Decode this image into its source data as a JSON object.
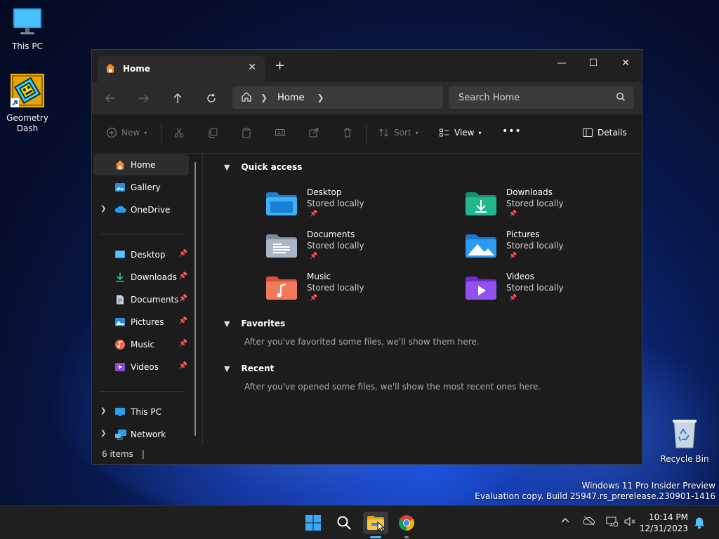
{
  "desktop": {
    "icons": [
      {
        "label": "This PC"
      },
      {
        "label": "Geometry\nDash"
      },
      {
        "label": "Recycle Bin"
      }
    ],
    "watermark_line1": "Windows 11 Pro Insider Preview",
    "watermark_line2": "Evaluation copy. Build 25947.rs_prerelease.230901-1416"
  },
  "window": {
    "tab_title": "Home",
    "tab_close": "✕",
    "new_tab": "+",
    "controls": {
      "minimize": "—",
      "maximize": "☐",
      "close": "✕"
    },
    "address": {
      "crumb": "Home"
    },
    "search_placeholder": "Search Home",
    "toolbar": {
      "new_label": "New",
      "sort_label": "Sort",
      "view_label": "View",
      "more_label": "•••",
      "details_label": "Details"
    },
    "nav": {
      "items": [
        {
          "label": "Home"
        },
        {
          "label": "Gallery"
        },
        {
          "label": "OneDrive"
        },
        {
          "label": "Desktop"
        },
        {
          "label": "Downloads"
        },
        {
          "label": "Documents"
        },
        {
          "label": "Pictures"
        },
        {
          "label": "Music"
        },
        {
          "label": "Videos"
        },
        {
          "label": "This PC"
        },
        {
          "label": "Network"
        }
      ]
    },
    "content": {
      "quick_access_title": "Quick access",
      "favorites_title": "Favorites",
      "favorites_note": "After you've favorited some files, we'll show them here.",
      "recent_title": "Recent",
      "recent_note": "After you've opened some files, we'll show the most recent ones here.",
      "quick_access": [
        {
          "name": "Desktop",
          "sub": "Stored locally"
        },
        {
          "name": "Downloads",
          "sub": "Stored locally"
        },
        {
          "name": "Documents",
          "sub": "Stored locally"
        },
        {
          "name": "Pictures",
          "sub": "Stored locally"
        },
        {
          "name": "Music",
          "sub": "Stored locally"
        },
        {
          "name": "Videos",
          "sub": "Stored locally"
        }
      ]
    },
    "status": "6 items"
  },
  "taskbar": {
    "time": "10:14 PM",
    "date": "12/31/2023"
  },
  "colors": {
    "accent": "#4cc2ff",
    "window_bg": "#1c1c1c",
    "taskbar_bg": "#1f1f1f"
  }
}
